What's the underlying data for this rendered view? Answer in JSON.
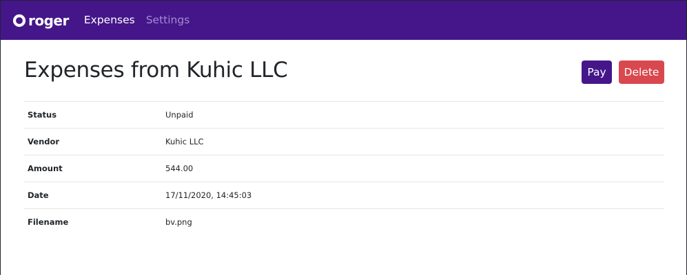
{
  "nav": {
    "brand": "roger",
    "links": [
      {
        "label": "Expenses",
        "active": true
      },
      {
        "label": "Settings",
        "active": false
      }
    ]
  },
  "page": {
    "title": "Expenses from Kuhic LLC"
  },
  "actions": {
    "pay_label": "Pay",
    "delete_label": "Delete"
  },
  "details": [
    {
      "key": "Status",
      "value": "Unpaid"
    },
    {
      "key": "Vendor",
      "value": "Kuhic LLC"
    },
    {
      "key": "Amount",
      "value": "544.00"
    },
    {
      "key": "Date",
      "value": "17/11/2020, 14:45:03"
    },
    {
      "key": "Filename",
      "value": "bv.png"
    }
  ],
  "colors": {
    "brand_purple": "#45168a",
    "danger": "#d9484f",
    "nav_muted": "#a48bd0"
  },
  "icons": {
    "brand_logo": "ring-logo-icon"
  }
}
